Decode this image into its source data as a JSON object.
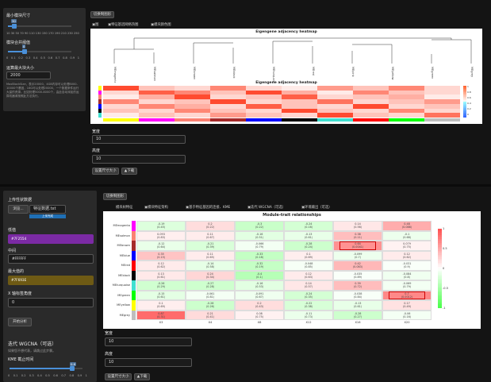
{
  "top_sidebar": {
    "min_module_label": "最小模块尺寸",
    "min_module_value": "30",
    "min_module_ticks": [
      "10",
      "30",
      "50",
      "70",
      "90",
      "110",
      "130",
      "150",
      "170",
      "190",
      "210",
      "230",
      "250"
    ],
    "merge_label": "模块合并阈值",
    "merge_value": "0",
    "merge_ticks": [
      "0",
      "0.1",
      "0.2",
      "0.3",
      "0.4",
      "0.5",
      "0.6",
      "0.7",
      "0.8",
      "0.9",
      "1"
    ],
    "block_label": "运算最大块大小",
    "block_value": "2000",
    "description": "MaxBlockSize，表示20000，4GB内存可以处理8000-10000个基因，16G可以处理20000，一个数据条件运行大量的资源。比如处理5000-8000个，由此自动添加的运算机器请按照此方法执行。"
  },
  "top_main": {
    "button": "切换制图形",
    "tabs": [
      "图",
      "特征基因网络热图",
      "模块颜色图"
    ],
    "dendro_title": "Eigengene adjacency heatmap",
    "dendro_leaves": [
      "MEmagenta",
      "MEsalmon",
      "MEbrown",
      "MEblack",
      "MEturquoise",
      "MEred",
      "MEpink",
      "MEyellow",
      "MEgreen",
      "MEgrey"
    ],
    "heatmap_title": "Eigengene adjacency heatmap",
    "heatmap_scale": [
      "1",
      "0.8",
      "0.6",
      "0.4",
      "0.2",
      "0"
    ],
    "width_label": "宽度",
    "width_value": "10",
    "height_label": "高度",
    "height_value": "10",
    "set_size_button": "设置尺寸大小",
    "download_button": "下载"
  },
  "bottom_sidebar": {
    "upload_label": "上传性状数据",
    "browse_button": "浏览...",
    "file_name": "特征数据.txt",
    "upload_status": "上传完成",
    "low_label": "低值",
    "low_color": "#7F2554",
    "mid_label": "中间",
    "mid_color": "#FFFFFF",
    "high_label": "最大值的",
    "high_color": "#7F693E",
    "angle_label": "X 轴标签角度",
    "angle_value": "0",
    "analyze_button": "开始分析",
    "iter_title": "迭代 WGCNA（可选）",
    "iter_desc": "如果您不想代表，请跳过此步骤。",
    "kme_label": "KME 截止时间",
    "kme_value": "0.6",
    "kme_ticks": [
      "0",
      "0.1",
      "0.2",
      "0.3",
      "0.4",
      "0.5",
      "0.6",
      "0.7",
      "0.8",
      "0.9",
      "1"
    ]
  },
  "bottom_main": {
    "button": "切换制图形",
    "tabs": [
      "模块树特征",
      "模块特征架构",
      "基于特征基因的连接、KME",
      "迭代 WGCNA（可选）",
      "环境输出（可选）"
    ],
    "heatmap_title": "Module-trait relationships",
    "columns": [
      "X3",
      "X4",
      "X8",
      "X12",
      "X16",
      "X20"
    ],
    "rows": [
      {
        "name": "MEmagenta",
        "color": "#ff00ff",
        "cells": [
          "-0.19\n(0.45)",
          "0.2\n(0.22)",
          "-0.3\n(0.22)",
          "-0.24\n(0.16)",
          "0.14\n(0.56)",
          "0.48\n(0.088)"
        ]
      },
      {
        "name": "MEsalmon",
        "color": "#fa8072",
        "cells": [
          "0.093\n(0.83)",
          "0.11\n(0.67)",
          "-0.16\n(0.51)",
          "-0.13\n(0.61)",
          "0.38\n(0.11)",
          "-0.1\n(0.68)"
        ]
      },
      {
        "name": "MEbrown",
        "color": "#a52a2a",
        "cells": [
          "-0.12\n(0.64)",
          "-0.21\n(0.39)",
          "-0.066\n(0.79)",
          "-0.28\n(0.24)",
          "0.64\n(0.0041)",
          "0.079\n(0.75)"
        ]
      },
      {
        "name": "MEblue",
        "color": "#0000ff",
        "cells": [
          "0.35\n(0.15)",
          "0.11\n(0.65)",
          "-0.33\n(0.18)",
          "0.1\n(0.69)",
          "-0.099\n(0.7)",
          "0.12\n(0.62)"
        ]
      },
      {
        "name": "MEred",
        "color": "#ff0000",
        "cells": [
          "0.12\n(0.62)",
          "-0.14\n(0.58)",
          "-0.32\n(0.19)",
          "-0.048\n(0.85)",
          "0.42\n(0.083)",
          "-0.031\n(0.9)"
        ]
      },
      {
        "name": "MEblack",
        "color": "#000000",
        "cells": [
          "0.13\n(0.61)",
          "0.24\n(0.34)",
          "-0.4\n(0.1)",
          "0.12\n(0.63)",
          "-0.035\n(0.89)",
          "-0.084\n(0.8)"
        ]
      },
      {
        "name": "MEturquoise",
        "color": "#40e0d0",
        "cells": [
          "-0.26\n(0.29)",
          "-0.27\n(0.28)",
          "-0.16\n(0.53)",
          "0.14\n(0.57)",
          "0.39\n(0.72)",
          "-0.069\n(0.79)"
        ]
      },
      {
        "name": "MEgreen",
        "color": "#00ff00",
        "cells": [
          "-0.15\n(0.61)",
          "-0.061\n(0.81)",
          "-0.091\n(0.67)",
          "-0.24\n(0.35)",
          "-0.038\n(0.84)",
          "0.7\n(0.0012)"
        ]
      },
      {
        "name": "MEyellow",
        "color": "#ffff00",
        "cells": [
          "0.1\n(0.69)",
          "-0.28\n(0.26)",
          "0.2\n(0.43)",
          "-0.22\n(0.38)",
          "-0.13\n(0.61)",
          "0.17\n(0.49)"
        ]
      },
      {
        "name": "MEgrey",
        "color": "#bebebe",
        "cells": [
          "0.87\n(0.31)",
          "0.21\n(0.41)",
          "0.08\n(0.75)",
          "-0.11\n(0.73)",
          "-0.28\n(0.27)",
          "-0.06\n(0.16)"
        ]
      }
    ],
    "values": [
      [
        -0.19,
        0.2,
        -0.3,
        -0.24,
        0.14,
        0.48
      ],
      [
        0.093,
        0.11,
        -0.16,
        -0.13,
        0.38,
        -0.1
      ],
      [
        -0.12,
        -0.21,
        -0.066,
        -0.28,
        0.64,
        0.079
      ],
      [
        0.35,
        0.11,
        -0.33,
        0.1,
        -0.099,
        0.12
      ],
      [
        0.12,
        -0.14,
        -0.32,
        -0.048,
        0.42,
        -0.031
      ],
      [
        0.13,
        0.24,
        -0.4,
        0.12,
        -0.035,
        -0.084
      ],
      [
        -0.26,
        -0.27,
        -0.16,
        0.14,
        0.39,
        -0.069
      ],
      [
        -0.15,
        -0.061,
        -0.091,
        -0.24,
        -0.038,
        0.7
      ],
      [
        0.1,
        -0.28,
        0.2,
        -0.22,
        -0.13,
        0.17
      ],
      [
        0.87,
        0.21,
        0.08,
        -0.11,
        -0.28,
        -0.06
      ]
    ],
    "highlighted": [
      [
        2,
        4
      ],
      [
        7,
        5
      ]
    ],
    "scale_labels": [
      "1",
      "0.5",
      "0",
      "-0.5",
      "-1"
    ],
    "width_label": "宽度",
    "width_value": "10",
    "height_label": "高度",
    "height_value": "10",
    "set_size_button": "设置尺寸大小",
    "download_button": "下载"
  }
}
